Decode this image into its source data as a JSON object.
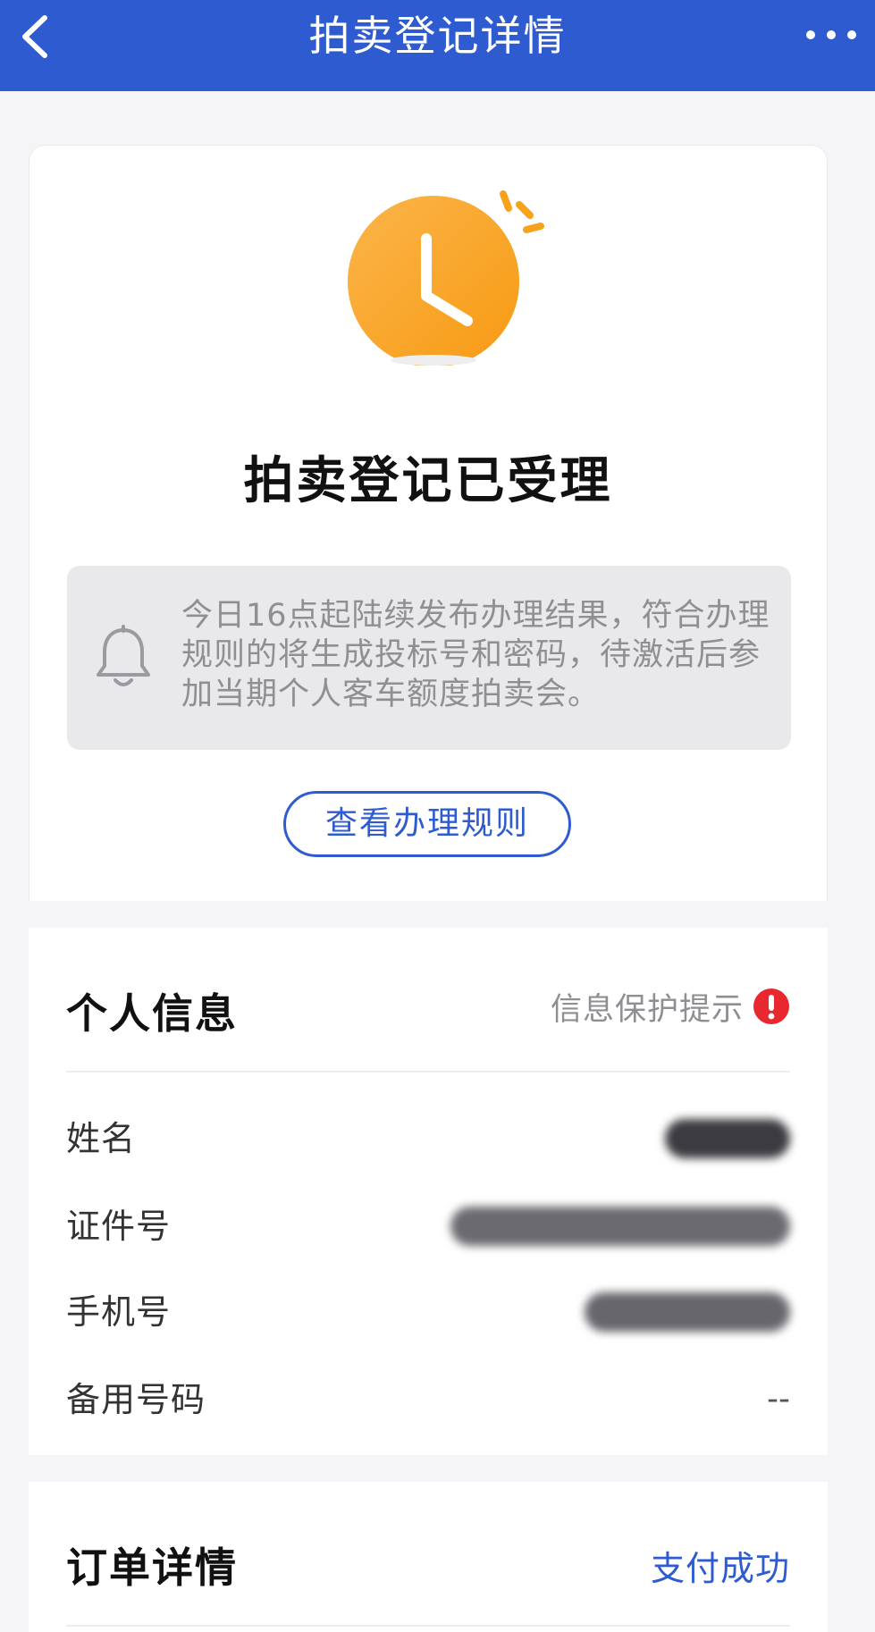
{
  "header": {
    "title": "拍卖登记详情"
  },
  "status": {
    "title": "拍卖登记已受理"
  },
  "notice": {
    "text": "今日16点起陆续发布办理结果，符合办理规则的将生成投标号和密码，待激活后参加当期个人客车额度拍卖会。"
  },
  "rules_button": {
    "label": "查看办理规则"
  },
  "personal_info": {
    "title": "个人信息",
    "privacy_label": "信息保护提示",
    "rows": [
      {
        "label": "姓名",
        "value": ""
      },
      {
        "label": "证件号",
        "value": ""
      },
      {
        "label": "手机号",
        "value": ""
      },
      {
        "label": "备用号码",
        "value": "--"
      }
    ]
  },
  "order": {
    "title": "订单详情",
    "status": "支付成功"
  },
  "colors": {
    "brand": "#2e5bcf",
    "accent": "#f7a21b",
    "alert": "#e8272e"
  }
}
